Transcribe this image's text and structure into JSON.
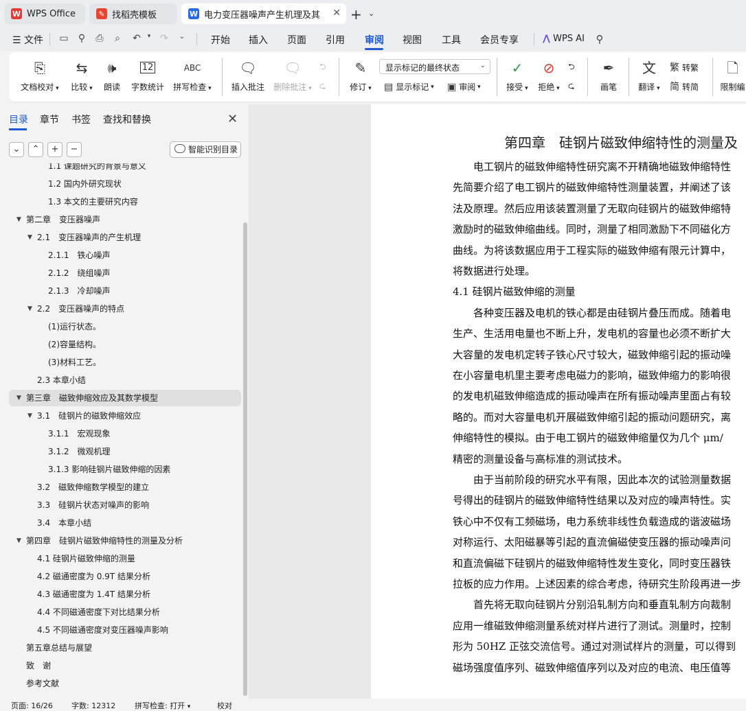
{
  "tabs": [
    {
      "label": "WPS Office",
      "icon": "wps-logo-icon"
    },
    {
      "label": "找稻壳模板",
      "icon": "docer-icon"
    },
    {
      "label": "电力变压器噪声产生机理及其影",
      "icon": "word-doc-icon"
    }
  ],
  "menu": {
    "file": "文件",
    "items": [
      "开始",
      "插入",
      "页面",
      "引用",
      "审阅",
      "视图",
      "工具",
      "会员专享"
    ],
    "active": "审阅",
    "ai": "WPS AI"
  },
  "ribbon": {
    "proofread": "文档校对",
    "compare": "比较",
    "read_aloud": "朗读",
    "word_count": "字数统计",
    "spell_check": "拼写检查",
    "spell_icon_text": "ABC",
    "count_icon_text": "12",
    "insert_comment": "插入批注",
    "delete_comment": "删除批注",
    "revise": "修订",
    "show_markup_state": "显示标记的最终状态",
    "show_markup": "显示标记",
    "review": "审阅",
    "accept": "接受",
    "reject": "拒绝",
    "pen": "画笔",
    "translate": "翻译",
    "to_traditional": "转繁",
    "to_simplified": "转简",
    "restrict_edit": "限制编"
  },
  "sidebar": {
    "tabs": [
      "目录",
      "章节",
      "书签",
      "查找和替换"
    ],
    "smart_button": "智能识别目录",
    "toc": [
      {
        "label": "1.1 课题研究的背景与意义",
        "level": 3,
        "arrow": ""
      },
      {
        "label": "1.2 国内外研究现状",
        "level": 3,
        "arrow": ""
      },
      {
        "label": "1.3 本文的主要研究内容",
        "level": 3,
        "arrow": ""
      },
      {
        "label": "第二章　变压器噪声",
        "level": 1,
        "arrow": "▼"
      },
      {
        "label": "2.1　变压器噪声的产生机理",
        "level": 2,
        "arrow": "▼"
      },
      {
        "label": "2.1.1　铁心噪声",
        "level": 3,
        "arrow": ""
      },
      {
        "label": "2.1.2　绕组噪声",
        "level": 3,
        "arrow": ""
      },
      {
        "label": "2.1.3　冷却噪声",
        "level": 3,
        "arrow": ""
      },
      {
        "label": "2.2　变压器噪声的特点",
        "level": 2,
        "arrow": "▼"
      },
      {
        "label": "(1)运行状态。",
        "level": 3,
        "arrow": ""
      },
      {
        "label": "(2)容量结构。",
        "level": 3,
        "arrow": ""
      },
      {
        "label": "(3)材料工艺。",
        "level": 3,
        "arrow": ""
      },
      {
        "label": "2.3 本章小结",
        "level": 2,
        "arrow": ""
      },
      {
        "label": "第三章　磁致伸缩效应及其数学模型",
        "level": 1,
        "arrow": "▼",
        "selected": true
      },
      {
        "label": "3.1　硅钢片的磁致伸缩效应",
        "level": 2,
        "arrow": "▼"
      },
      {
        "label": "3.1.1　宏观现象",
        "level": 3,
        "arrow": ""
      },
      {
        "label": "3.1.2　微观机理",
        "level": 3,
        "arrow": ""
      },
      {
        "label": "3.1.3 影响硅钢片磁致伸缩的因素",
        "level": 3,
        "arrow": ""
      },
      {
        "label": "3.2　磁致伸缩数学模型的建立",
        "level": 2,
        "arrow": ""
      },
      {
        "label": "3.3　硅钢片状态对噪声的影响",
        "level": 2,
        "arrow": ""
      },
      {
        "label": "3.4　本章小结",
        "level": 2,
        "arrow": ""
      },
      {
        "label": "第四章　硅钢片磁致伸缩特性的测量及分析",
        "level": 1,
        "arrow": "▼"
      },
      {
        "label": "4.1 硅钢片磁致伸缩的测量",
        "level": 2,
        "arrow": ""
      },
      {
        "label": "4.2 磁通密度为 0.9T 结果分析",
        "level": 2,
        "arrow": ""
      },
      {
        "label": "4.3 磁通密度为 1.4T 结果分析",
        "level": 2,
        "arrow": ""
      },
      {
        "label": "4.4 不同磁通密度下对比结果分析",
        "level": 2,
        "arrow": ""
      },
      {
        "label": "4.5 不同磁通密度对变压器噪声影响",
        "level": 2,
        "arrow": ""
      },
      {
        "label": "第五章总结与展望",
        "level": 1,
        "arrow": ""
      },
      {
        "label": "致　谢",
        "level": 1,
        "arrow": ""
      },
      {
        "label": "参考文献",
        "level": 1,
        "arrow": ""
      }
    ]
  },
  "document": {
    "title": "第四章　硅钢片磁致伸缩特性的测量及",
    "lines": [
      "　　电工钢片的磁致伸缩特性研究离不开精确地磁致伸缩特性",
      "先简要介绍了电工钢片的磁致伸缩特性测量装置，并阐述了该",
      "法及原理。然后应用该装置测量了无取向硅钢片的磁致伸缩特",
      "激励时的磁致伸缩曲线。同时，测量了相同激励下不同磁化方",
      "曲线。为将该数据应用于工程实际的磁致伸缩有限元计算中，",
      "将数据进行处理。",
      "4.1  硅钢片磁致伸缩的测量",
      "　　各种变压器及电机的铁心都是由硅钢片叠压而成。随着电",
      "生产、生活用电量也不断上升，发电机的容量也必须不断扩大",
      "大容量的发电机定转子铁心尺寸较大，磁致伸缩引起的振动噪",
      "在小容量电机里主要考虑电磁力的影响，磁致伸缩力的影响很",
      "的发电机磁致伸缩造成的振动噪声在所有振动噪声里面占有较",
      "略的。而对大容量电机开展磁致伸缩引起的振动问题研究，离",
      "伸缩特性的模拟。由于电工钢片的磁致伸缩量仅为几个 μm/",
      "精密的测量设备与高标准的测试技术。",
      "　　由于当前阶段的研究水平有限，因此本次的试验测量数据",
      "号得出的硅钢片的磁致伸缩特性结果以及对应的噪声特性。实",
      "铁心中不仅有工频磁场，电力系统非线性负载造成的谐波磁场",
      "对称运行、太阳磁暴等引起的直流偏磁使变压器的振动噪声问",
      "和直流偏磁下硅钢片的磁致伸缩特性发生变化，同时变压器铁",
      "拉板的应力作用。上述因素的综合考虑，待研究生阶段再进一步",
      "　　首先将无取向硅钢片分别沿轧制方向和垂直轧制方向裁制",
      "应用一维磁致伸缩测量系统对样片进行了测试。测量时，控制",
      "形为 50HZ 正弦交流信号。通过对测试样片的测量，可以得到",
      "磁场强度值序列、磁致伸缩值序列以及对应的电流、电压值等"
    ]
  },
  "status": {
    "page": "页面: 16/26",
    "words": "字数: 12312",
    "spell": "拼写检查: 打开",
    "proof": "校对"
  }
}
